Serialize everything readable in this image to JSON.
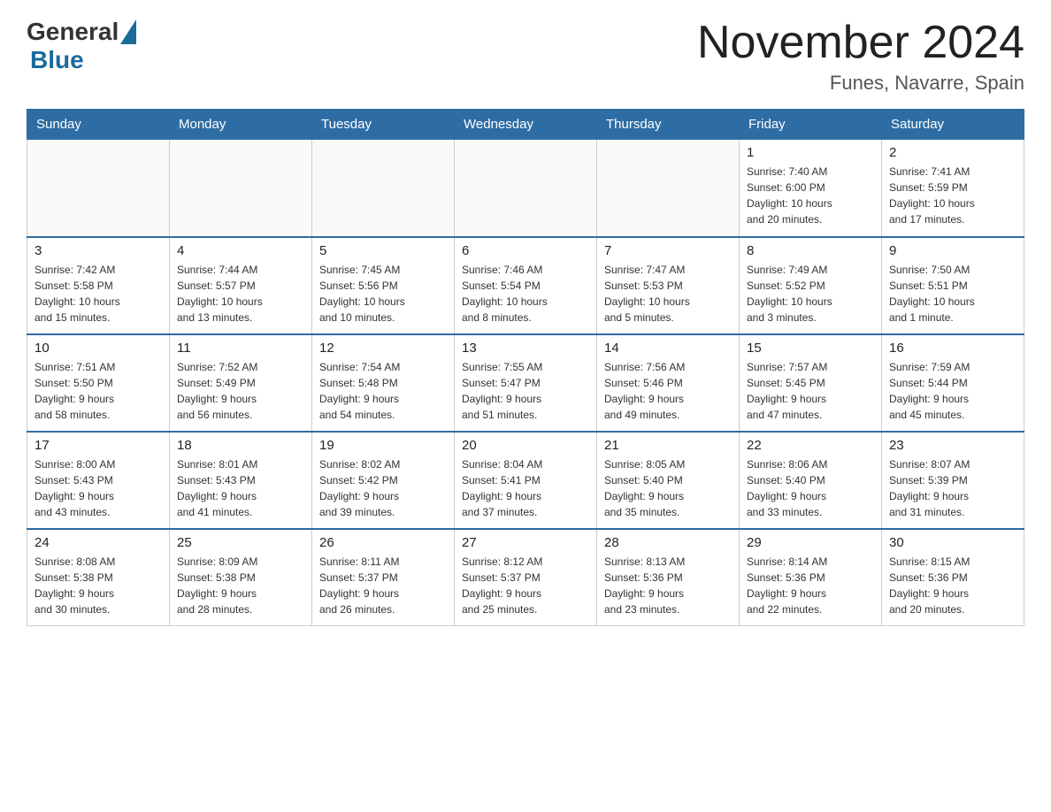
{
  "logo": {
    "general": "General",
    "blue": "Blue"
  },
  "header": {
    "title": "November 2024",
    "location": "Funes, Navarre, Spain"
  },
  "weekdays": [
    "Sunday",
    "Monday",
    "Tuesday",
    "Wednesday",
    "Thursday",
    "Friday",
    "Saturday"
  ],
  "weeks": [
    [
      {
        "day": "",
        "info": ""
      },
      {
        "day": "",
        "info": ""
      },
      {
        "day": "",
        "info": ""
      },
      {
        "day": "",
        "info": ""
      },
      {
        "day": "",
        "info": ""
      },
      {
        "day": "1",
        "info": "Sunrise: 7:40 AM\nSunset: 6:00 PM\nDaylight: 10 hours\nand 20 minutes."
      },
      {
        "day": "2",
        "info": "Sunrise: 7:41 AM\nSunset: 5:59 PM\nDaylight: 10 hours\nand 17 minutes."
      }
    ],
    [
      {
        "day": "3",
        "info": "Sunrise: 7:42 AM\nSunset: 5:58 PM\nDaylight: 10 hours\nand 15 minutes."
      },
      {
        "day": "4",
        "info": "Sunrise: 7:44 AM\nSunset: 5:57 PM\nDaylight: 10 hours\nand 13 minutes."
      },
      {
        "day": "5",
        "info": "Sunrise: 7:45 AM\nSunset: 5:56 PM\nDaylight: 10 hours\nand 10 minutes."
      },
      {
        "day": "6",
        "info": "Sunrise: 7:46 AM\nSunset: 5:54 PM\nDaylight: 10 hours\nand 8 minutes."
      },
      {
        "day": "7",
        "info": "Sunrise: 7:47 AM\nSunset: 5:53 PM\nDaylight: 10 hours\nand 5 minutes."
      },
      {
        "day": "8",
        "info": "Sunrise: 7:49 AM\nSunset: 5:52 PM\nDaylight: 10 hours\nand 3 minutes."
      },
      {
        "day": "9",
        "info": "Sunrise: 7:50 AM\nSunset: 5:51 PM\nDaylight: 10 hours\nand 1 minute."
      }
    ],
    [
      {
        "day": "10",
        "info": "Sunrise: 7:51 AM\nSunset: 5:50 PM\nDaylight: 9 hours\nand 58 minutes."
      },
      {
        "day": "11",
        "info": "Sunrise: 7:52 AM\nSunset: 5:49 PM\nDaylight: 9 hours\nand 56 minutes."
      },
      {
        "day": "12",
        "info": "Sunrise: 7:54 AM\nSunset: 5:48 PM\nDaylight: 9 hours\nand 54 minutes."
      },
      {
        "day": "13",
        "info": "Sunrise: 7:55 AM\nSunset: 5:47 PM\nDaylight: 9 hours\nand 51 minutes."
      },
      {
        "day": "14",
        "info": "Sunrise: 7:56 AM\nSunset: 5:46 PM\nDaylight: 9 hours\nand 49 minutes."
      },
      {
        "day": "15",
        "info": "Sunrise: 7:57 AM\nSunset: 5:45 PM\nDaylight: 9 hours\nand 47 minutes."
      },
      {
        "day": "16",
        "info": "Sunrise: 7:59 AM\nSunset: 5:44 PM\nDaylight: 9 hours\nand 45 minutes."
      }
    ],
    [
      {
        "day": "17",
        "info": "Sunrise: 8:00 AM\nSunset: 5:43 PM\nDaylight: 9 hours\nand 43 minutes."
      },
      {
        "day": "18",
        "info": "Sunrise: 8:01 AM\nSunset: 5:43 PM\nDaylight: 9 hours\nand 41 minutes."
      },
      {
        "day": "19",
        "info": "Sunrise: 8:02 AM\nSunset: 5:42 PM\nDaylight: 9 hours\nand 39 minutes."
      },
      {
        "day": "20",
        "info": "Sunrise: 8:04 AM\nSunset: 5:41 PM\nDaylight: 9 hours\nand 37 minutes."
      },
      {
        "day": "21",
        "info": "Sunrise: 8:05 AM\nSunset: 5:40 PM\nDaylight: 9 hours\nand 35 minutes."
      },
      {
        "day": "22",
        "info": "Sunrise: 8:06 AM\nSunset: 5:40 PM\nDaylight: 9 hours\nand 33 minutes."
      },
      {
        "day": "23",
        "info": "Sunrise: 8:07 AM\nSunset: 5:39 PM\nDaylight: 9 hours\nand 31 minutes."
      }
    ],
    [
      {
        "day": "24",
        "info": "Sunrise: 8:08 AM\nSunset: 5:38 PM\nDaylight: 9 hours\nand 30 minutes."
      },
      {
        "day": "25",
        "info": "Sunrise: 8:09 AM\nSunset: 5:38 PM\nDaylight: 9 hours\nand 28 minutes."
      },
      {
        "day": "26",
        "info": "Sunrise: 8:11 AM\nSunset: 5:37 PM\nDaylight: 9 hours\nand 26 minutes."
      },
      {
        "day": "27",
        "info": "Sunrise: 8:12 AM\nSunset: 5:37 PM\nDaylight: 9 hours\nand 25 minutes."
      },
      {
        "day": "28",
        "info": "Sunrise: 8:13 AM\nSunset: 5:36 PM\nDaylight: 9 hours\nand 23 minutes."
      },
      {
        "day": "29",
        "info": "Sunrise: 8:14 AM\nSunset: 5:36 PM\nDaylight: 9 hours\nand 22 minutes."
      },
      {
        "day": "30",
        "info": "Sunrise: 8:15 AM\nSunset: 5:36 PM\nDaylight: 9 hours\nand 20 minutes."
      }
    ]
  ]
}
